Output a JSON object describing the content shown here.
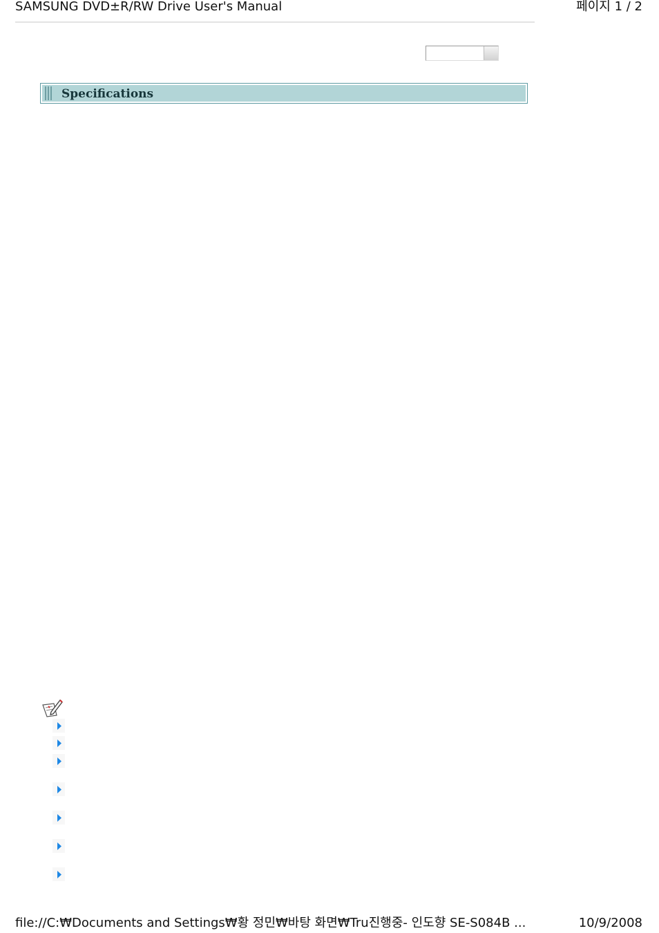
{
  "header": {
    "title": "SAMSUNG DVD±R/RW Drive User's Manual",
    "page_indicator": "페이지 1 / 2"
  },
  "section": {
    "title": "Specifications"
  },
  "select": {
    "value": ""
  },
  "notes": {
    "icon": "note-pencil-icon",
    "bullet_icon": "blue-triangle-bullet-icon",
    "bullet_count": 7
  },
  "footer": {
    "path": "file://C:₩Documents and Settings₩황 정민₩바탕 화면₩Tru진행중- 인도향 SE-S084B ...",
    "date": "10/9/2008"
  },
  "colors": {
    "section_bar": "#b2d5d7",
    "section_border": "#5d9aa2",
    "bullet": "#1e88e5"
  }
}
